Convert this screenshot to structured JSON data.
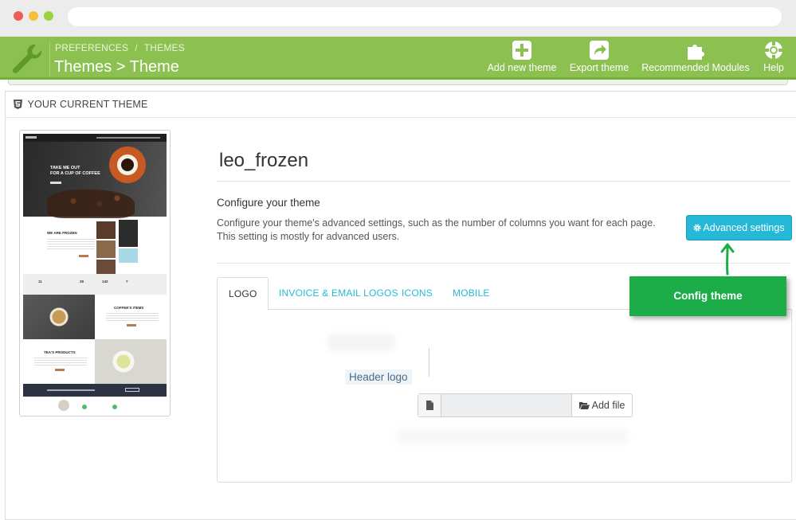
{
  "toolbar": {
    "breadcrumb": [
      "PREFERENCES",
      "/",
      "THEMES"
    ],
    "page_title": "Themes > Theme",
    "buttons": [
      {
        "label": "Add new theme",
        "icon": "plus-square-icon"
      },
      {
        "label": "Export theme",
        "icon": "share-square-icon"
      },
      {
        "label": "Recommended Modules",
        "icon": "puzzle-icon"
      },
      {
        "label": "Help",
        "icon": "lifebuoy-icon"
      }
    ],
    "color": "#8cc152"
  },
  "panel": {
    "heading": "YOUR CURRENT THEME",
    "theme_name": "leo_frozen",
    "configure_title": "Configure your theme",
    "configure_desc_line1": "Configure your theme's advanced settings, such as the number of columns you want for each page.",
    "configure_desc_line2": "This setting is mostly for advanced users.",
    "advanced_button": "Advanced settings",
    "callout": "Config theme"
  },
  "preview": {
    "hero_line1": "TAKE ME OUT",
    "hero_line2": "FOR A CUP OF COFFEE",
    "we_are": "WE ARE FROZEN",
    "stats": [
      "11",
      "29",
      "142",
      "7"
    ],
    "coffee_items": "COFFEE'S ITEMS",
    "tea_products": "TEA'S PRODUCTS"
  },
  "tabs": {
    "items": [
      "LOGO",
      "INVOICE & EMAIL LOGOS",
      "ICONS",
      "MOBILE"
    ],
    "active": "LOGO"
  },
  "logo_tab": {
    "header_logo_label": "Header logo",
    "add_file_label": "Add file"
  },
  "colors": {
    "accent": "#25b9d7",
    "callout": "#1dad48"
  }
}
